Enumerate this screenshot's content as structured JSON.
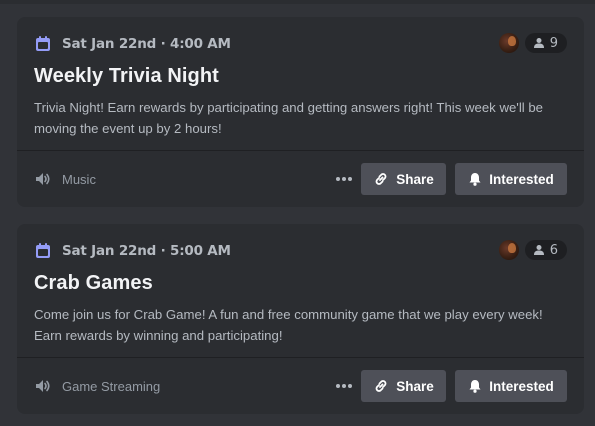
{
  "events": [
    {
      "date": "Sat Jan 22nd · 4:00 AM",
      "interested_count": "9",
      "title": "Weekly Trivia Night",
      "description": "Trivia Night! Earn rewards by participating and getting answers right! This week we'll be moving the event up by 2 hours!",
      "location": "Music",
      "share_label": "Share",
      "interested_label": "Interested"
    },
    {
      "date": "Sat Jan 22nd · 5:00 AM",
      "interested_count": "6",
      "title": "Crab Games",
      "description": "Come join us for Crab Game! A fun and free community game that we play every week! Earn rewards by winning and participating!",
      "location": "Game Streaming",
      "share_label": "Share",
      "interested_label": "Interested"
    }
  ],
  "colors": {
    "background": "#313338",
    "card": "#2b2d31",
    "calendar_icon": "#949cf7",
    "button": "#4e5058",
    "title_text": "#f2f3f5",
    "muted_text": "#b5bac1"
  },
  "icons": {
    "calendar": "calendar-icon",
    "attendees": "person-icon",
    "location": "voice-speaker-icon",
    "more": "more-dots-icon",
    "share": "link-icon",
    "interested": "bell-icon"
  }
}
